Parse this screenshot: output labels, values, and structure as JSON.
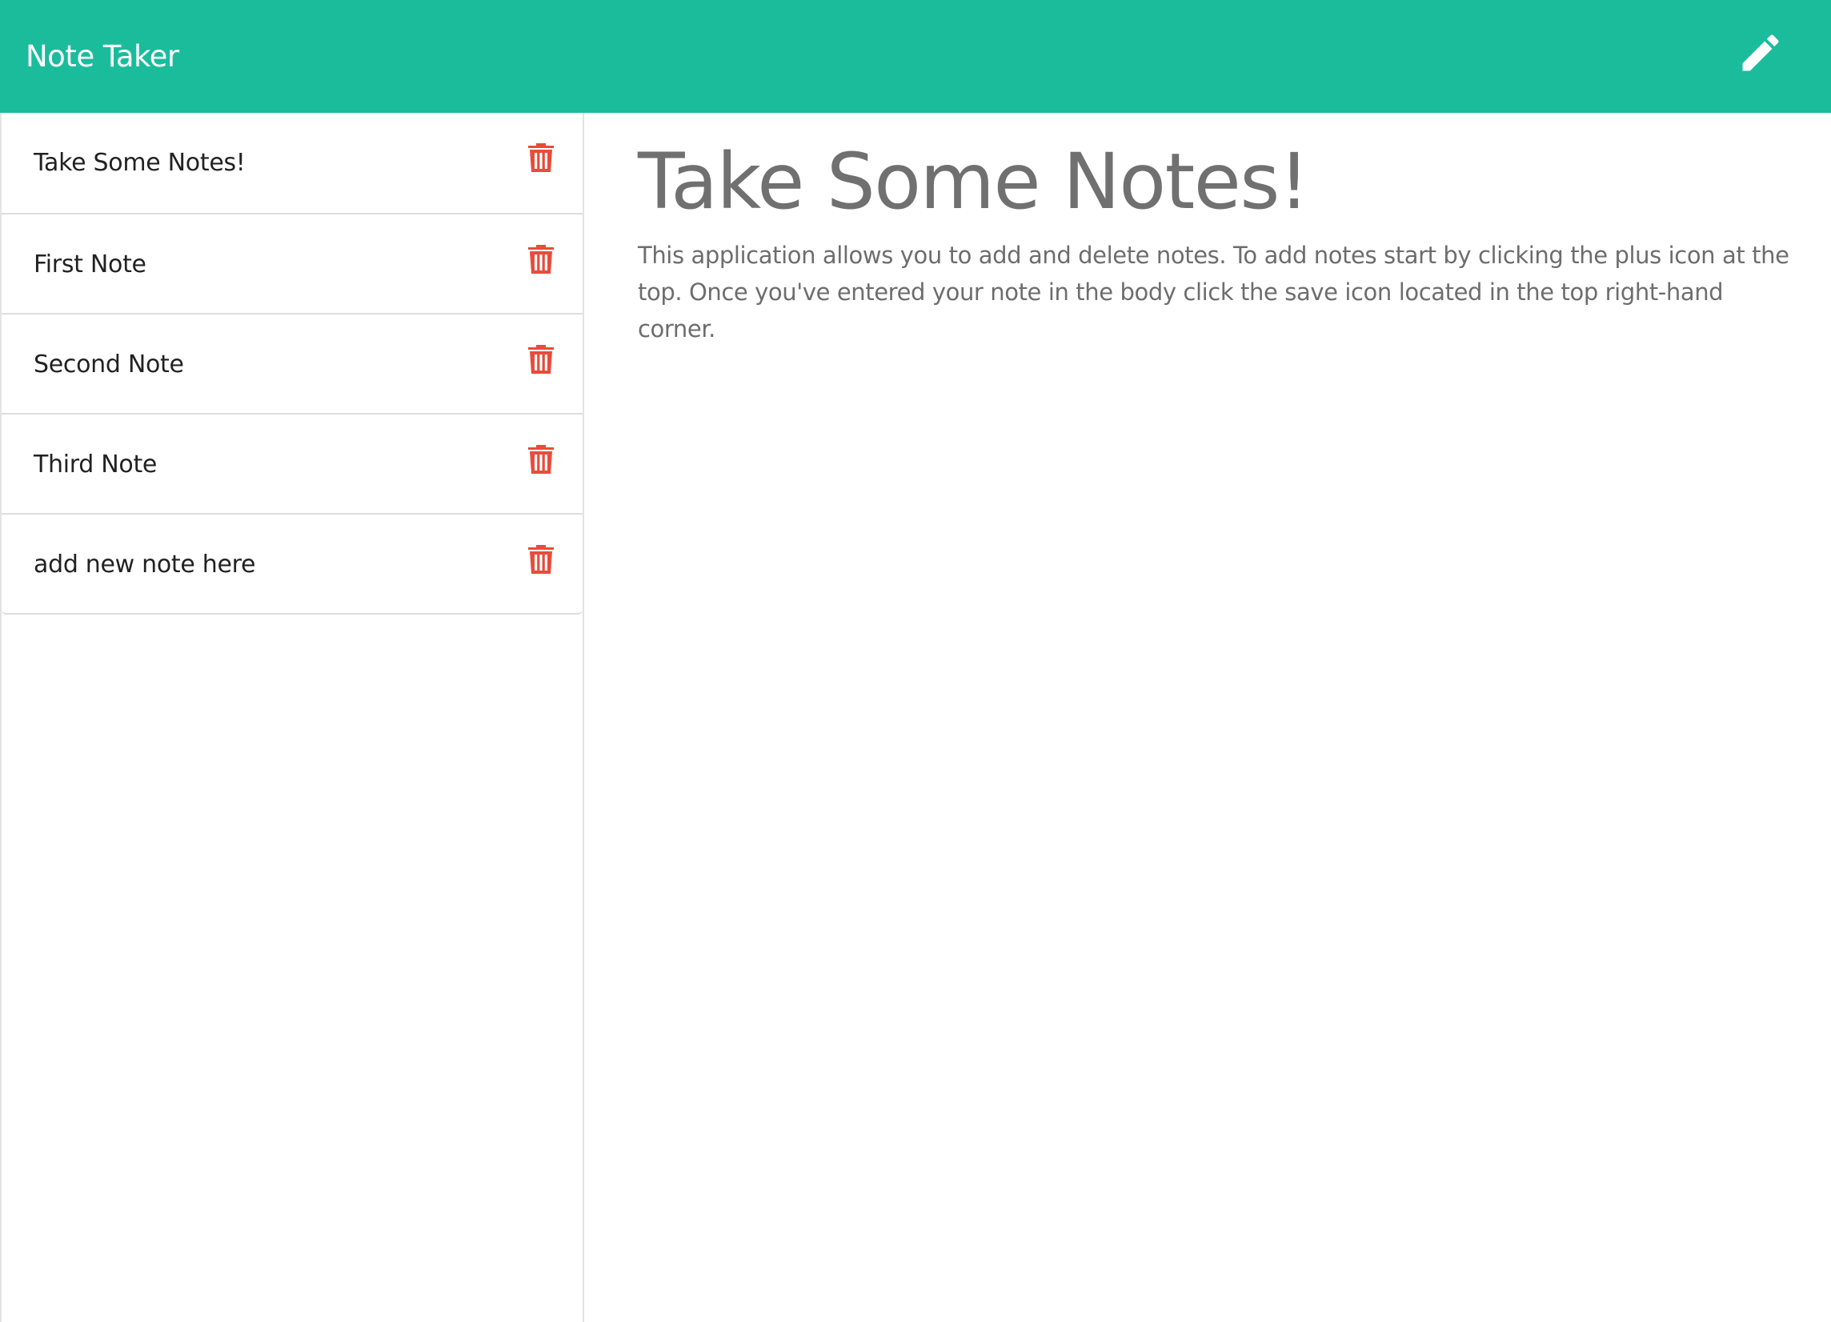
{
  "navbar": {
    "brand": "Note Taker",
    "edit_icon": "pencil-icon",
    "background_color": "#1abc9c"
  },
  "sidebar": {
    "notes": [
      {
        "title": "Take Some Notes!",
        "delete_icon": "trash-icon"
      },
      {
        "title": "First Note",
        "delete_icon": "trash-icon"
      },
      {
        "title": "Second Note",
        "delete_icon": "trash-icon"
      },
      {
        "title": "Third Note",
        "delete_icon": "trash-icon"
      },
      {
        "title": "add new note here",
        "delete_icon": "trash-icon"
      }
    ],
    "delete_icon_color": "#e74c3c"
  },
  "main": {
    "title": "Take Some Notes!",
    "body": "This application allows you to add and delete notes. To add notes start by clicking the plus icon at the top. Once you've entered your note in the body click the save icon located in the top right-hand corner."
  }
}
